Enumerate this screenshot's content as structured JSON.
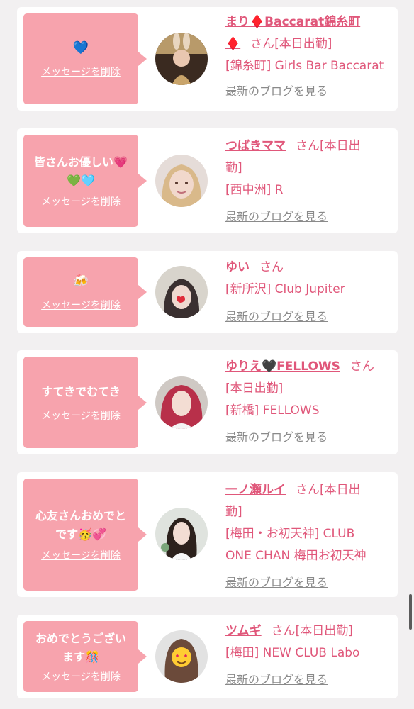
{
  "delete_label": "メッセージを削除",
  "blog_label": "最新のブログを見る",
  "san_label": "さん",
  "cards": [
    {
      "message": "",
      "message_emoji": "💙",
      "name": "まり♦️Baccarat錦糸町♦️",
      "name_line1": "まり♦️Baccarat錦糸町",
      "name_line2": "♦️",
      "status": "[本日出勤]",
      "shop": "[錦糸町] Girls Bar Baccarat",
      "avatar_icon": "woman-with-bunny-ears-photo"
    },
    {
      "message": "皆さんお優しい💗",
      "message_line2": "💚🩵",
      "name": "つばきママ",
      "status_line1": "[本日出",
      "status_line2": "勤]",
      "shop": "[西中洲] R",
      "avatar_icon": "blonde-woman-photo"
    },
    {
      "message": "",
      "message_emoji": "🍻",
      "name": "ゆい",
      "shop": "[新所沢] Club Jupiter",
      "avatar_icon": "woman-with-heart-sticker-photo"
    },
    {
      "message": "すてきでむてき",
      "name": "ゆりえ🖤FELLOWS",
      "status": "[本日出勤]",
      "shop": "[新橋] FELLOWS",
      "avatar_icon": "pink-haired-woman-photo"
    },
    {
      "message": "心友さんおめでと",
      "message_line2": "です🥳💞",
      "name": "一ノ瀬ルイ",
      "status_line1": "[本日出",
      "status_line2": "勤]",
      "shop_line1": "[梅田・お初天神] CLUB",
      "shop_line2": "ONE CHAN 梅田お初天神",
      "avatar_icon": "woman-in-white-dress-photo"
    },
    {
      "message": "おめでとうござい",
      "message_line2": "ます🎊",
      "name": "ツムギ",
      "status": "[本日出勤]",
      "shop": "[梅田] NEW CLUB Labo",
      "avatar_icon": "woman-with-heart-eyes-emoji-photo"
    }
  ]
}
